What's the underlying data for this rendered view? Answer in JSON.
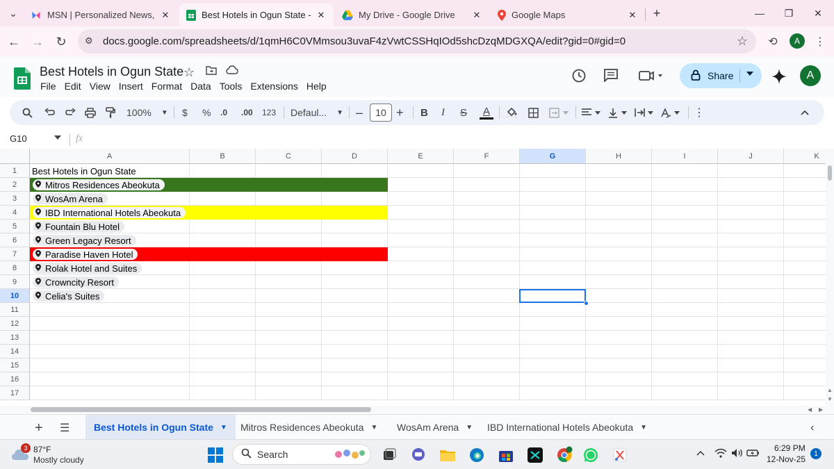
{
  "browser": {
    "tabs": [
      {
        "label": "MSN | Personalized News, Top Headlines"
      },
      {
        "label": "Best Hotels in Ogun State - Google Sheets"
      },
      {
        "label": "My Drive - Google Drive"
      },
      {
        "label": "Google Maps"
      }
    ],
    "url": "docs.google.com/spreadsheets/d/1qmH6C0VMmsou3uvaF4zVwtCSSHqIOd5shcDzqMDGXQA/edit?gid=0#gid=0",
    "profile_initial": "A"
  },
  "sheets": {
    "title": "Best Hotels in Ogun State",
    "menu": [
      "File",
      "Edit",
      "View",
      "Insert",
      "Format",
      "Data",
      "Tools",
      "Extensions",
      "Help"
    ],
    "share_label": "Share",
    "avatar_initial": "A",
    "toolbar": {
      "zoom": "100%",
      "currency": "$",
      "percent": "%",
      "dec_decrease": ".0",
      "dec_increase": ".00",
      "number_format": "123",
      "font": "Defaul...",
      "font_size": "10",
      "bold": "B",
      "italic": "I",
      "strike": "S",
      "text_color": "A",
      "minus": "–",
      "plus": "+"
    },
    "name_box": "G10",
    "fx": "fx",
    "columns": [
      "A",
      "B",
      "C",
      "D",
      "E",
      "F",
      "G",
      "H",
      "I",
      "J",
      "K"
    ],
    "selected_column": "G",
    "rows": [
      "1",
      "2",
      "3",
      "4",
      "5",
      "6",
      "7",
      "8",
      "9",
      "10",
      "11",
      "12",
      "13",
      "14",
      "15",
      "16",
      "17"
    ],
    "selected_row": "10",
    "header_cell": "Best Hotels in Ogun State",
    "hotels": [
      {
        "name": "Mitros Residences Abeokuta",
        "fill": "#38761d"
      },
      {
        "name": "WosAm Arena",
        "fill": ""
      },
      {
        "name": "IBD International Hotels Abeokuta",
        "fill": "#ffff00"
      },
      {
        "name": "Fountain Blu Hotel",
        "fill": ""
      },
      {
        "name": "Green Legacy Resort",
        "fill": ""
      },
      {
        "name": "Paradise Haven Hotel",
        "fill": "#ff0000"
      },
      {
        "name": "Rolak Hotel and Suites",
        "fill": ""
      },
      {
        "name": "Crowncity Resort",
        "fill": ""
      },
      {
        "name": "Celia's Suites",
        "fill": ""
      }
    ],
    "sheet_tabs": [
      {
        "label": "Best Hotels in Ogun State",
        "active": true
      },
      {
        "label": "Mitros Residences Abeokuta",
        "active": false
      },
      {
        "label": "WosAm Arena",
        "active": false
      },
      {
        "label": "IBD International Hotels Abeokuta",
        "active": false
      }
    ]
  },
  "taskbar": {
    "weather_temp": "87°F",
    "weather_desc": "Mostly cloudy",
    "weather_badge": "3",
    "search_label": "Search",
    "time": "6:29 PM",
    "date": "12-Nov-25",
    "notification_count": "1"
  }
}
